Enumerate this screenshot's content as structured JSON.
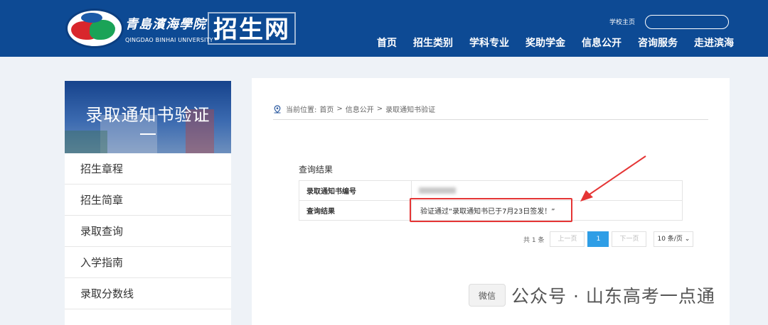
{
  "header": {
    "logo_cn": "青島濱海學院",
    "logo_en": "QINGDAO BINHAI UNIVERSITY",
    "site_name": "招生网",
    "home_link": "学校主页",
    "search_placeholder": "",
    "brand_color": "#0d4a94",
    "nav": [
      "首页",
      "招生类别",
      "学科专业",
      "奖助学金",
      "信息公开",
      "咨询服务",
      "走进滨海"
    ]
  },
  "sidebar": {
    "banner_title": "录取通知书验证",
    "items": [
      "招生章程",
      "招生简章",
      "录取查询",
      "入学指南",
      "录取分数线"
    ]
  },
  "breadcrumb": {
    "prefix": "当前位置:",
    "items": [
      "首页",
      "信息公开",
      "录取通知书验证"
    ],
    "separator": ">"
  },
  "result": {
    "title": "查询结果",
    "rows": [
      {
        "label": "录取通知书编号",
        "value": ""
      },
      {
        "label": "查询结果",
        "value": "验证通过“录取通知书已于7月23日签发！”"
      }
    ],
    "highlight_color": "#e53535"
  },
  "pager": {
    "total": "共 1 条",
    "prev": "上一页",
    "current": "1",
    "next": "下一页",
    "page_size": "10 条/页",
    "accent": "#2f9ee6"
  },
  "watermark": {
    "icon_text": "微信",
    "text": "公众号 · 山东高考一点通"
  }
}
